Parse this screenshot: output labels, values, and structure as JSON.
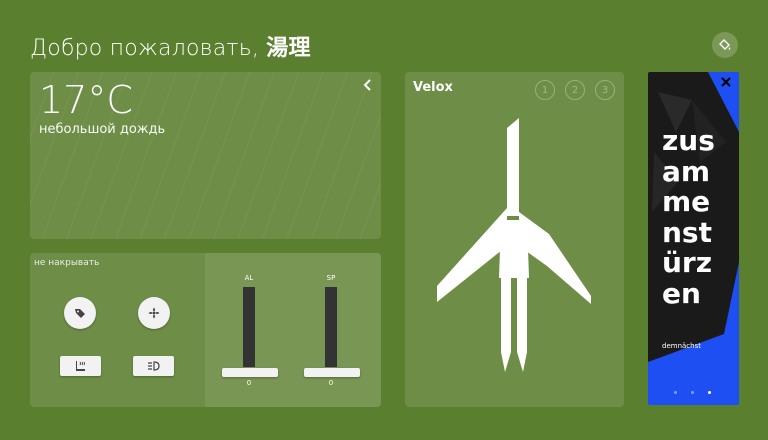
{
  "header": {
    "greeting": "Добро пожаловать,",
    "user_name": "湯理",
    "theme_icon": "paint-bucket-icon"
  },
  "weather": {
    "temperature": "17°C",
    "description": "небольшой дождь",
    "back_icon": "chevron-left-icon"
  },
  "controls": {
    "do_not_cover_label": "не накрывать",
    "buttons": [
      {
        "name": "tag-button",
        "icon": "tag-icon"
      },
      {
        "name": "fan-button",
        "icon": "fan-icon"
      },
      {
        "name": "seat-heater-button",
        "icon": "seat-heater-icon"
      },
      {
        "name": "headlight-button",
        "icon": "headlight-icon"
      }
    ],
    "sliders": [
      {
        "label": "AL",
        "value": "0"
      },
      {
        "label": "SP",
        "value": "0"
      }
    ]
  },
  "velox": {
    "title": "Velox",
    "steps": [
      "1",
      "2",
      "3"
    ]
  },
  "ad": {
    "headline_lines": [
      "zus",
      "am",
      "me",
      "nst",
      "ürz",
      "en"
    ],
    "tagline": "demnächst",
    "close_icon": "close-icon",
    "page_dots": 3,
    "active_dot": 3,
    "colors": {
      "background": "#1d4ff2",
      "dark": "#1a1a1a"
    }
  },
  "colors": {
    "page_background": "#5a7f2e"
  }
}
